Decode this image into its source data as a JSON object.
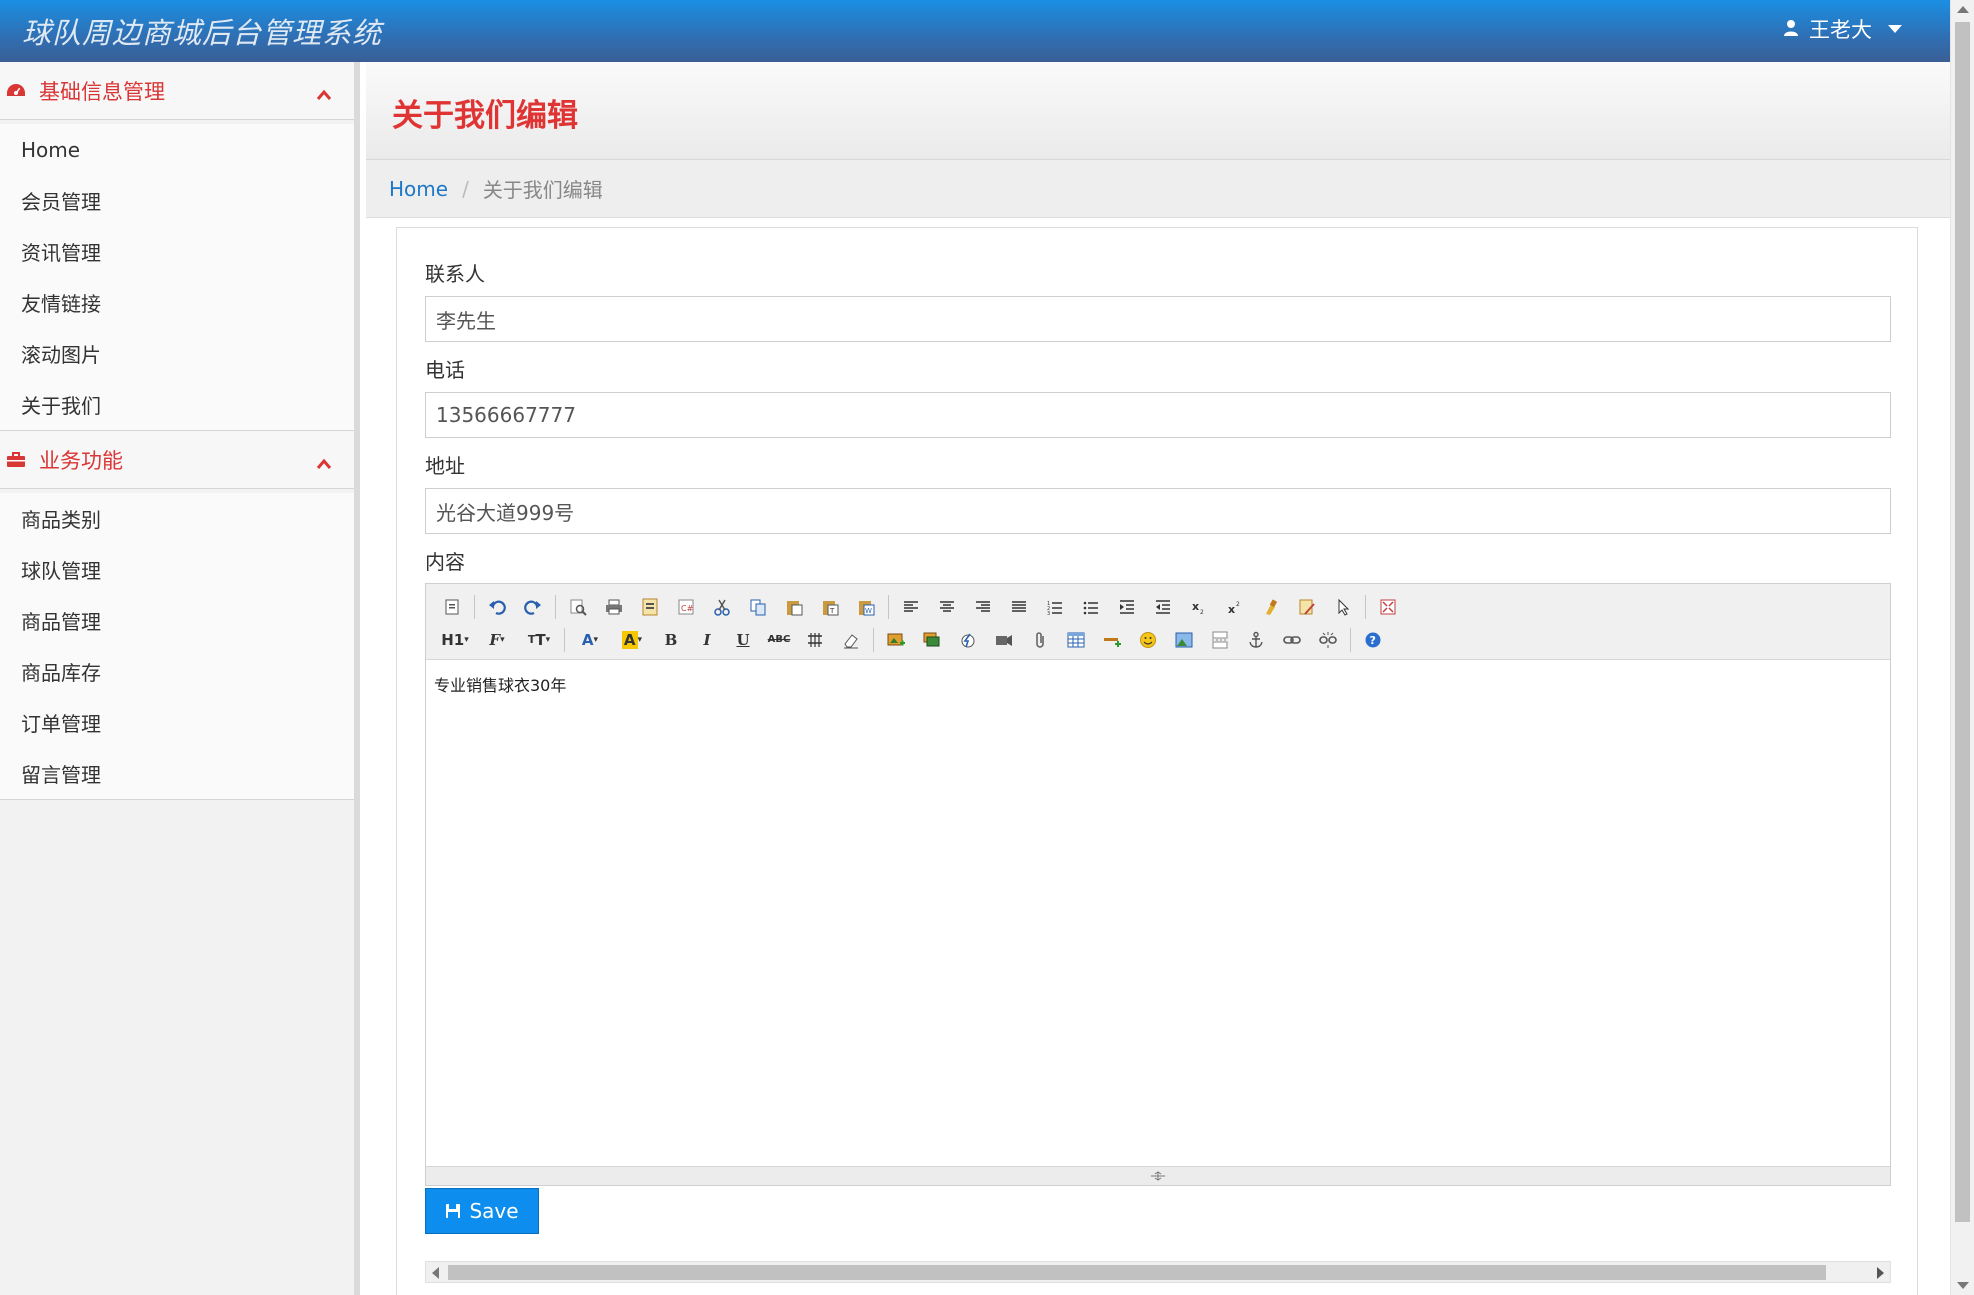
{
  "header": {
    "title": "球队周边商城后台管理系统",
    "user_name": "王老大",
    "user_icon": "user-icon",
    "dropdown_icon": "caret-down-icon"
  },
  "sidebar": {
    "sections": [
      {
        "label": "基础信息管理",
        "icon": "dashboard-icon",
        "items": [
          {
            "label": "Home"
          },
          {
            "label": "会员管理"
          },
          {
            "label": "资讯管理"
          },
          {
            "label": "友情链接"
          },
          {
            "label": "滚动图片"
          },
          {
            "label": "关于我们"
          }
        ]
      },
      {
        "label": "业务功能",
        "icon": "briefcase-icon",
        "items": [
          {
            "label": "商品类别"
          },
          {
            "label": "球队管理"
          },
          {
            "label": "商品管理"
          },
          {
            "label": "商品库存"
          },
          {
            "label": "订单管理"
          },
          {
            "label": "留言管理"
          }
        ]
      }
    ]
  },
  "main": {
    "page_title": "关于我们编辑",
    "breadcrumb": {
      "home": "Home",
      "separator": "/",
      "current": "关于我们编辑"
    },
    "form": {
      "contact_label": "联系人",
      "contact_value": "李先生",
      "phone_label": "电话",
      "phone_value": "13566667777",
      "address_label": "地址",
      "address_value": "光谷大道999号",
      "content_label": "内容",
      "content_value": "专业销售球衣30年",
      "save_label": "Save"
    }
  },
  "colors": {
    "accent_red": "#e03434",
    "header_blue": "#1a8fe3",
    "save_blue": "#0d8eee",
    "link_blue": "#1f78c7"
  }
}
